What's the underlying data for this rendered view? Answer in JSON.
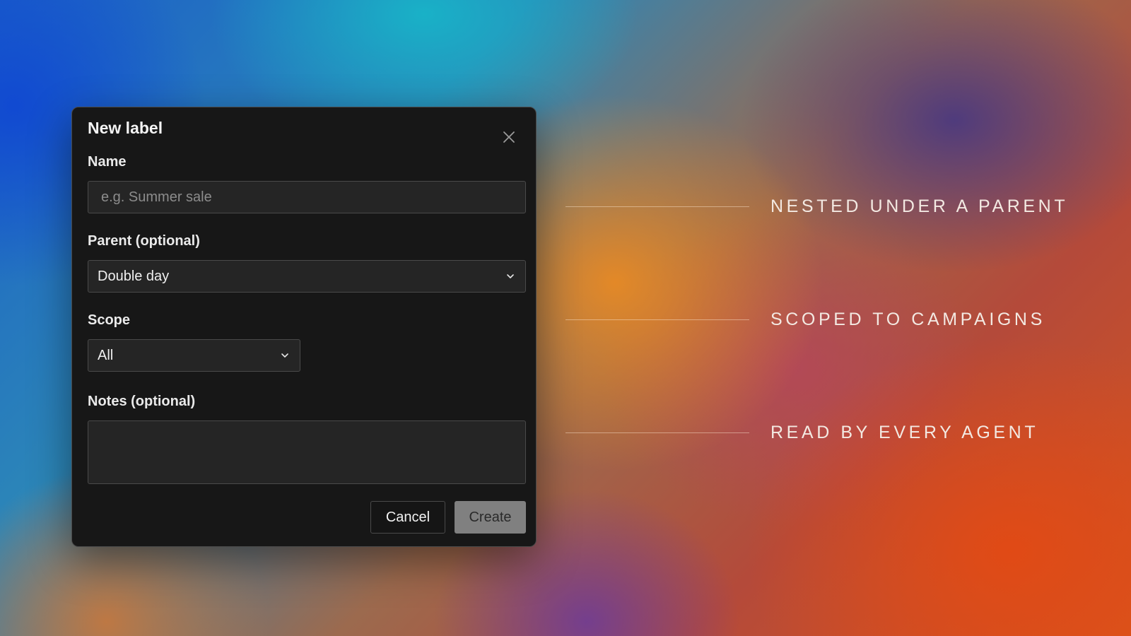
{
  "dialog": {
    "title": "New label",
    "close_icon": "close-icon",
    "fields": {
      "name": {
        "label": "Name",
        "value": "",
        "placeholder": "e.g. Summer sale"
      },
      "parent": {
        "label": "Parent (optional)",
        "selected": "Double day",
        "icon": "chevron-down-icon"
      },
      "scope": {
        "label": "Scope",
        "selected": "All",
        "icon": "chevron-down-icon"
      },
      "notes": {
        "label": "Notes (optional)",
        "value": ""
      }
    },
    "buttons": {
      "cancel_label": "Cancel",
      "create_label": "Create"
    }
  },
  "callouts": [
    {
      "text": "NESTED UNDER A PARENT"
    },
    {
      "text": "SCOPED TO CAMPAIGNS"
    },
    {
      "text": "READ BY EVERY AGENT"
    }
  ],
  "colors": {
    "dialog_bg": "#171717",
    "input_bg": "#252525",
    "border": "#4a4a4a",
    "create_button_bg": "#808080",
    "text": "#f2f2f2",
    "placeholder": "#8c8c8c"
  }
}
